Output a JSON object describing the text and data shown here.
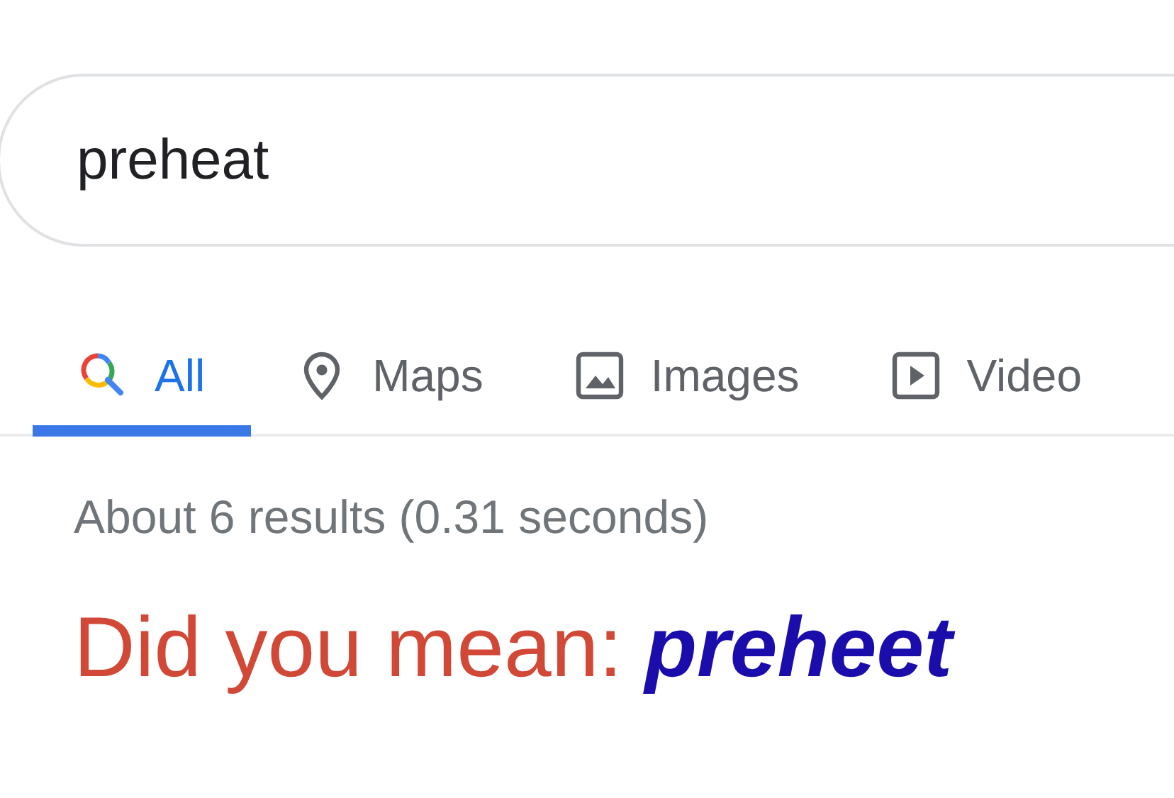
{
  "search": {
    "value": "preheat"
  },
  "tabs": [
    {
      "label": "All",
      "kind": "all",
      "selected": true
    },
    {
      "label": "Maps",
      "kind": "maps",
      "selected": false
    },
    {
      "label": "Images",
      "kind": "images",
      "selected": false
    },
    {
      "label": "Video",
      "kind": "videos",
      "selected": false
    }
  ],
  "result_stats": "About 6 results (0.31 seconds)",
  "spelling": {
    "prompt": "Did you mean:",
    "suggestion": "preheet"
  }
}
